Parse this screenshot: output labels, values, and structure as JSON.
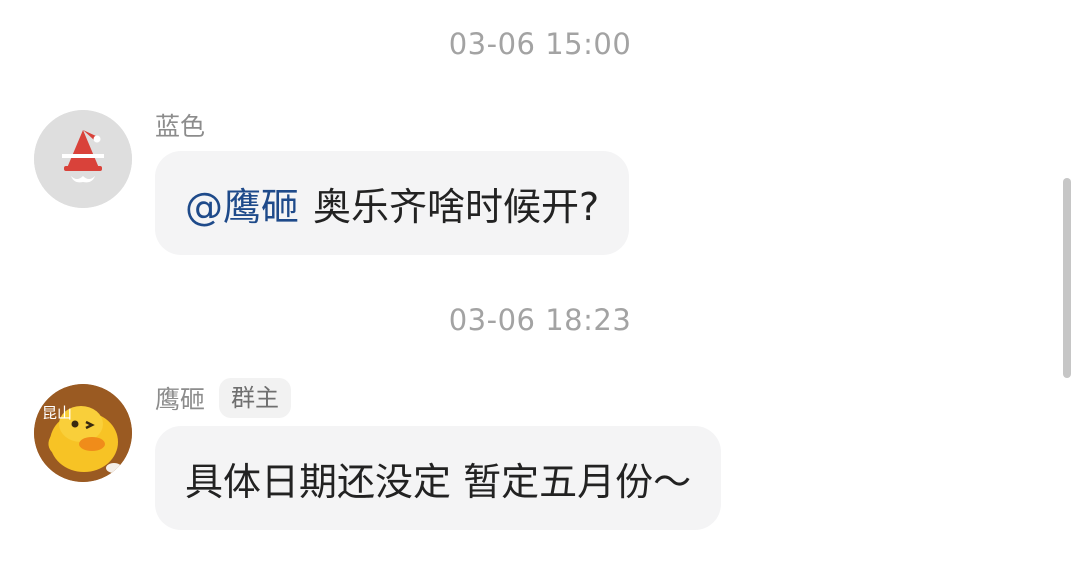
{
  "messages": [
    {
      "timestamp": "03-06 15:00",
      "sender": "蓝色",
      "mention": "@鹰砸",
      "text": "奥乐齐啥时候开?",
      "avatar_icon": "santa-hat-avatar-icon"
    },
    {
      "timestamp": "03-06 18:23",
      "sender": "鹰砸",
      "badge": "群主",
      "text": "具体日期还没定 暂定五月份～",
      "avatar_icon": "duck-avatar-icon",
      "avatar_text": "昆山"
    }
  ],
  "colors": {
    "bubble": "#f4f4f5",
    "mention": "#1e4a8a",
    "timestamp": "#a3a3a3",
    "santa_red": "#d9423a",
    "duck_yellow": "#f7c325",
    "duck_bg": "#9a5a22"
  }
}
